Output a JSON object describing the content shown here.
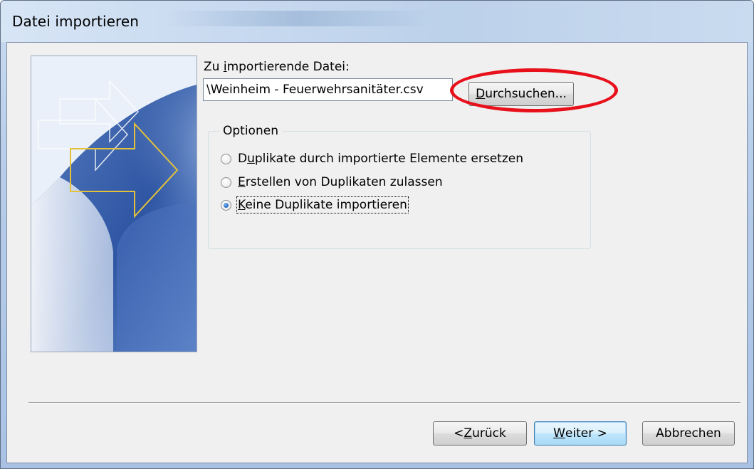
{
  "window": {
    "title": "Datei importieren"
  },
  "file": {
    "label_pre": "Zu ",
    "label_key": "i",
    "label_post": "mportierende Datei:",
    "value": "\\Weinheim - Feuerwehrsanitäter.csv",
    "browse_key": "D",
    "browse_rest": "urchsuchen..."
  },
  "options": {
    "title": "Optionen",
    "items": [
      {
        "key": "u",
        "pre": "D",
        "post": "plikate durch importierte Elemente ersetzen",
        "checked": false
      },
      {
        "key": "E",
        "pre": "",
        "post": "rstellen von Duplikaten zulassen",
        "checked": false
      },
      {
        "key": "K",
        "pre": "",
        "post": "eine Duplikate importieren",
        "checked": true
      }
    ]
  },
  "buttons": {
    "back_pre": "< ",
    "back_key": "Z",
    "back_post": "urück",
    "next_key": "W",
    "next_post": "eiter >",
    "cancel": "Abbrechen"
  },
  "colors": {
    "highlight": "#e8101a",
    "art_accent": "#e3c23a"
  }
}
